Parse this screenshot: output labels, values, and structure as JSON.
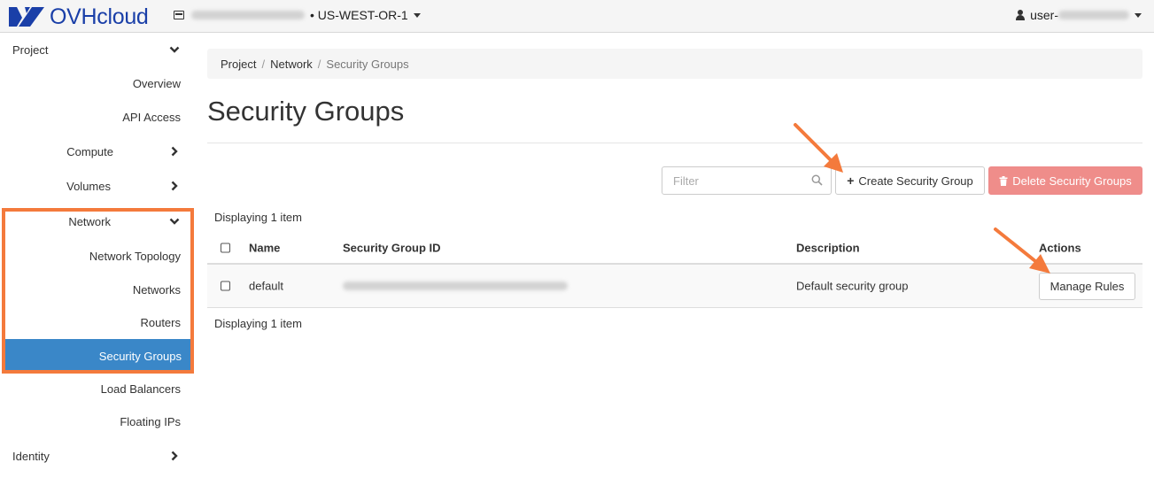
{
  "topbar": {
    "logo_text": "OVHcloud",
    "region": "• US-WEST-OR-1",
    "user_prefix": "user-"
  },
  "sidebar": {
    "project": "Project",
    "overview": "Overview",
    "api_access": "API Access",
    "compute": "Compute",
    "volumes": "Volumes",
    "network": "Network",
    "network_topology": "Network Topology",
    "networks": "Networks",
    "routers": "Routers",
    "security_groups": "Security Groups",
    "load_balancers": "Load Balancers",
    "floating_ips": "Floating IPs",
    "identity": "Identity"
  },
  "breadcrumb": {
    "project": "Project",
    "network": "Network",
    "current": "Security Groups",
    "sep": "/"
  },
  "page": {
    "title": "Security Groups"
  },
  "toolbar": {
    "filter_placeholder": "Filter",
    "create_label": "Create Security Group",
    "delete_label": "Delete Security Groups"
  },
  "table": {
    "count_top": "Displaying 1 item",
    "count_bottom": "Displaying 1 item",
    "headers": {
      "name": "Name",
      "id": "Security Group ID",
      "description": "Description",
      "actions": "Actions"
    },
    "rows": [
      {
        "name": "default",
        "description": "Default security group",
        "action": "Manage Rules"
      }
    ]
  },
  "colors": {
    "accent": "#3a87c8",
    "annotation": "#f47a3c",
    "danger": "#ef8d8a",
    "brand": "#1a3fa8"
  }
}
